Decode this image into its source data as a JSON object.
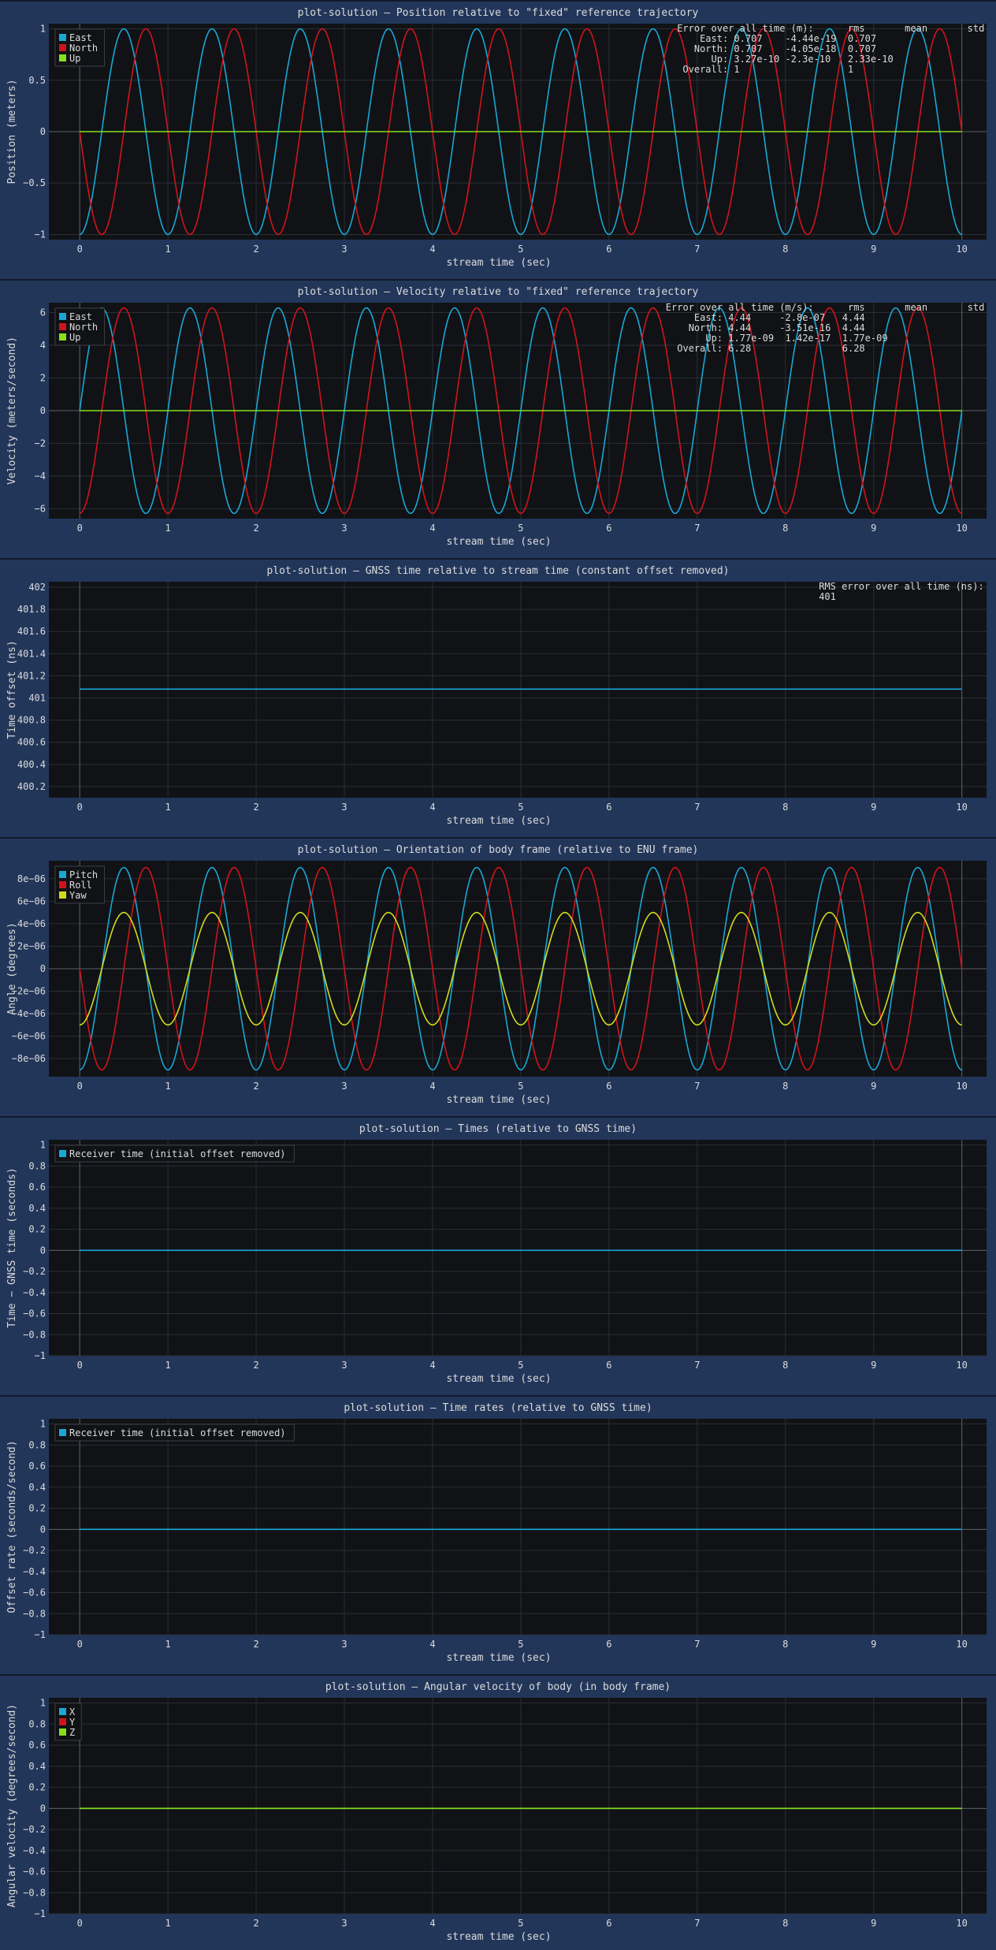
{
  "colors": {
    "panel_bg": "#22365a",
    "plot_bg": "#101215",
    "grid": "#2a2e35",
    "zero_line": "#5a5e66",
    "text": "#dcdcdc",
    "east": "#1aa7d6",
    "north": "#d0141c",
    "up": "#86e01e"
  },
  "chart_data": [
    {
      "type": "line",
      "title": "plot-solution – Position relative to \"fixed\" reference trajectory",
      "xlabel": "stream time (sec)",
      "ylabel": "Position (meters)",
      "xlim": [
        -0.35,
        10.28
      ],
      "ylim": [
        -1.05,
        1.05
      ],
      "xticks": [
        0,
        1,
        2,
        3,
        4,
        5,
        6,
        7,
        8,
        9,
        10
      ],
      "xtick_labels": [
        "0",
        "1",
        "2",
        "3",
        "4",
        "5",
        "6",
        "7",
        "8",
        "9",
        "10"
      ],
      "yticks": [
        -1,
        -0.5,
        0,
        0.5,
        1
      ],
      "ytick_labels": [
        "−1",
        "−0.5",
        "0",
        "0.5",
        "1"
      ],
      "legend": "top-left",
      "series": [
        {
          "name": "East",
          "color": "#1aa7d6",
          "kind": "sine",
          "amp": 1,
          "freq": 1,
          "phase": 0.75
        },
        {
          "name": "North",
          "color": "#d0141c",
          "kind": "sine",
          "amp": 1,
          "freq": 1,
          "phase": 0.5
        },
        {
          "name": "Up",
          "color": "#86e01e",
          "kind": "const",
          "value": 0
        }
      ],
      "stats_lines": [
        "Error over all time (m):      rms       mean       std",
        "    East: 0.707    -4.44e-19  0.707",
        "   North: 0.707    -4.05e-18  0.707",
        "      Up: 3.27e-10 -2.3e-10   2.33e-10",
        " Overall: 1                   1"
      ]
    },
    {
      "type": "line",
      "title": "plot-solution – Velocity relative to \"fixed\" reference trajectory",
      "xlabel": "stream time (sec)",
      "ylabel": "Velocity (meters/second)",
      "xlim": [
        -0.35,
        10.28
      ],
      "ylim": [
        -6.6,
        6.6
      ],
      "xticks": [
        0,
        1,
        2,
        3,
        4,
        5,
        6,
        7,
        8,
        9,
        10
      ],
      "xtick_labels": [
        "0",
        "1",
        "2",
        "3",
        "4",
        "5",
        "6",
        "7",
        "8",
        "9",
        "10"
      ],
      "yticks": [
        -6,
        -4,
        -2,
        0,
        2,
        4,
        6
      ],
      "ytick_labels": [
        "−6",
        "−4",
        "−2",
        "0",
        "2",
        "4",
        "6"
      ],
      "legend": "top-left",
      "series": [
        {
          "name": "East",
          "color": "#1aa7d6",
          "kind": "sine",
          "amp": 6.28,
          "freq": 1,
          "phase": 0
        },
        {
          "name": "North",
          "color": "#d0141c",
          "kind": "sine",
          "amp": 6.28,
          "freq": 1,
          "phase": 0.75
        },
        {
          "name": "Up",
          "color": "#86e01e",
          "kind": "const",
          "value": 0
        }
      ],
      "stats_lines": [
        "Error over all time (m/s):      rms       mean       std",
        "     East: 4.44     -2.8e-07   4.44",
        "    North: 4.44     -3.51e-16  4.44",
        "       Up: 1.77e-09  1.42e-17  1.77e-09",
        "  Overall: 6.28                6.28"
      ]
    },
    {
      "type": "line",
      "title": "plot-solution – GNSS time relative to stream time (constant offset removed)",
      "xlabel": "stream time (sec)",
      "ylabel": "Time offset (ns)",
      "xlim": [
        -0.35,
        10.28
      ],
      "ylim": [
        400.1,
        402.05
      ],
      "xticks": [
        0,
        1,
        2,
        3,
        4,
        5,
        6,
        7,
        8,
        9,
        10
      ],
      "xtick_labels": [
        "0",
        "1",
        "2",
        "3",
        "4",
        "5",
        "6",
        "7",
        "8",
        "9",
        "10"
      ],
      "yticks": [
        400.2,
        400.4,
        400.6,
        400.8,
        401,
        401.2,
        401.4,
        401.6,
        401.8,
        402
      ],
      "ytick_labels": [
        "400.2",
        "400.4",
        "400.6",
        "400.8",
        "401",
        "401.2",
        "401.4",
        "401.6",
        "401.8",
        "402"
      ],
      "legend": "none",
      "series": [
        {
          "color": "#1aa7d6",
          "kind": "const",
          "value": 401.08
        }
      ],
      "stats_lines": [
        "RMS error over all time (ns):",
        "401"
      ]
    },
    {
      "type": "line",
      "title": "plot-solution – Orientation of body frame (relative to ENU frame)",
      "xlabel": "stream time (sec)",
      "ylabel": "Angle (degrees)",
      "xlim": [
        -0.35,
        10.28
      ],
      "ylim": [
        -9.6e-06,
        9.6e-06
      ],
      "xticks": [
        0,
        1,
        2,
        3,
        4,
        5,
        6,
        7,
        8,
        9,
        10
      ],
      "xtick_labels": [
        "0",
        "1",
        "2",
        "3",
        "4",
        "5",
        "6",
        "7",
        "8",
        "9",
        "10"
      ],
      "yticks": [
        -8e-06,
        -6e-06,
        -4e-06,
        -2e-06,
        0,
        2e-06,
        4e-06,
        6e-06,
        8e-06
      ],
      "ytick_labels": [
        "−8e−06",
        "−6e−06",
        "−4e−06",
        "−2e−06",
        "0",
        "2e−06",
        "4e−06",
        "6e−06",
        "8e−06"
      ],
      "legend": "top-left",
      "series": [
        {
          "name": "Pitch",
          "color": "#1aa7d6",
          "kind": "sine",
          "amp": 9e-06,
          "freq": 1,
          "phase": 0.75
        },
        {
          "name": "Roll",
          "color": "#d0141c",
          "kind": "sine",
          "amp": 9e-06,
          "freq": 1,
          "phase": 0.5
        },
        {
          "name": "Yaw",
          "color": "#cfdc1e",
          "kind": "sine",
          "amp": 5e-06,
          "freq": 1,
          "phase": 0.75
        }
      ],
      "stats_lines": []
    },
    {
      "type": "line",
      "title": "plot-solution – Times (relative to GNSS time)",
      "xlabel": "stream time (sec)",
      "ylabel": "Time − GNSS time (seconds)",
      "xlim": [
        -0.35,
        10.28
      ],
      "ylim": [
        -1,
        1.05
      ],
      "xticks": [
        0,
        1,
        2,
        3,
        4,
        5,
        6,
        7,
        8,
        9,
        10
      ],
      "xtick_labels": [
        "0",
        "1",
        "2",
        "3",
        "4",
        "5",
        "6",
        "7",
        "8",
        "9",
        "10"
      ],
      "yticks": [
        -1,
        -0.8,
        -0.6,
        -0.4,
        -0.2,
        0,
        0.2,
        0.4,
        0.6,
        0.8,
        1
      ],
      "ytick_labels": [
        "−1",
        "−0.8",
        "−0.6",
        "−0.4",
        "−0.2",
        "0",
        "0.2",
        "0.4",
        "0.6",
        "0.8",
        "1"
      ],
      "legend": "top-left",
      "series": [
        {
          "name": "Receiver time (initial offset removed)",
          "color": "#1aa7d6",
          "kind": "const",
          "value": 0
        }
      ],
      "stats_lines": []
    },
    {
      "type": "line",
      "title": "plot-solution – Time rates (relative to GNSS time)",
      "xlabel": "stream time (sec)",
      "ylabel": "Offset rate (seconds/second)",
      "xlim": [
        -0.35,
        10.28
      ],
      "ylim": [
        -1,
        1.05
      ],
      "xticks": [
        0,
        1,
        2,
        3,
        4,
        5,
        6,
        7,
        8,
        9,
        10
      ],
      "xtick_labels": [
        "0",
        "1",
        "2",
        "3",
        "4",
        "5",
        "6",
        "7",
        "8",
        "9",
        "10"
      ],
      "yticks": [
        -1,
        -0.8,
        -0.6,
        -0.4,
        -0.2,
        0,
        0.2,
        0.4,
        0.6,
        0.8,
        1
      ],
      "ytick_labels": [
        "−1",
        "−0.8",
        "−0.6",
        "−0.4",
        "−0.2",
        "0",
        "0.2",
        "0.4",
        "0.6",
        "0.8",
        "1"
      ],
      "legend": "top-left",
      "series": [
        {
          "name": "Receiver time (initial offset removed)",
          "color": "#1aa7d6",
          "kind": "const",
          "value": 0
        }
      ],
      "stats_lines": []
    },
    {
      "type": "line",
      "title": "plot-solution – Angular velocity of body (in body frame)",
      "xlabel": "stream time (sec)",
      "ylabel": "Angular velocity (degrees/second)",
      "xlim": [
        -0.35,
        10.28
      ],
      "ylim": [
        -1,
        1.05
      ],
      "xticks": [
        0,
        1,
        2,
        3,
        4,
        5,
        6,
        7,
        8,
        9,
        10
      ],
      "xtick_labels": [
        "0",
        "1",
        "2",
        "3",
        "4",
        "5",
        "6",
        "7",
        "8",
        "9",
        "10"
      ],
      "yticks": [
        -1,
        -0.8,
        -0.6,
        -0.4,
        -0.2,
        0,
        0.2,
        0.4,
        0.6,
        0.8,
        1
      ],
      "ytick_labels": [
        "−1",
        "−0.8",
        "−0.6",
        "−0.4",
        "−0.2",
        "0",
        "0.2",
        "0.4",
        "0.6",
        "0.8",
        "1"
      ],
      "legend": "top-left",
      "series": [
        {
          "name": "X",
          "color": "#1aa7d6",
          "kind": "const",
          "value": 0
        },
        {
          "name": "Y",
          "color": "#d0141c",
          "kind": "const",
          "value": 0
        },
        {
          "name": "Z",
          "color": "#86e01e",
          "kind": "const",
          "value": 0
        }
      ],
      "stats_lines": []
    }
  ]
}
